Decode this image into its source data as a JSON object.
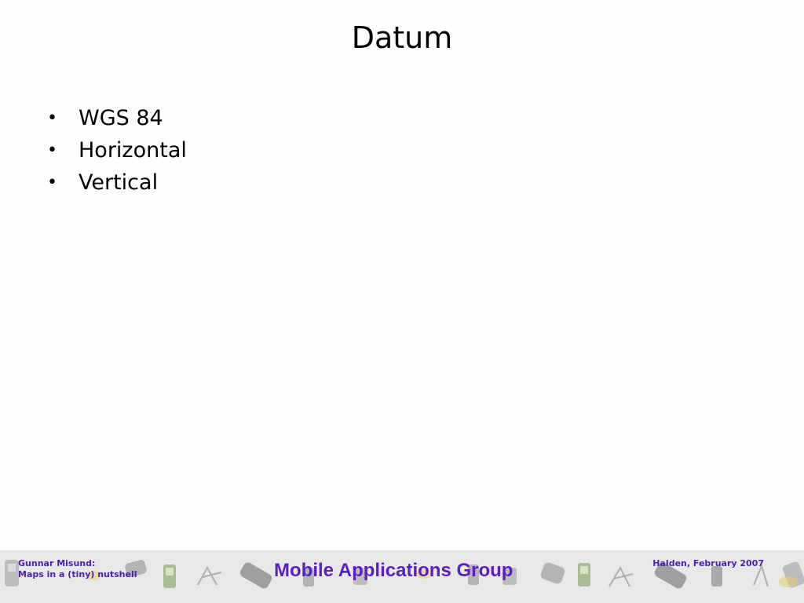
{
  "slide": {
    "title": "Datum",
    "bullets": [
      {
        "marker": "•",
        "text": "WGS 84"
      },
      {
        "marker": "•",
        "text": "Horizontal"
      },
      {
        "marker": "•",
        "text": "Vertical"
      }
    ]
  },
  "footer": {
    "author_line": "Gunnar Misund:",
    "talk_line": "Maps in a (tiny) nutshell",
    "group": "Mobile Applications Group",
    "place_date": "Halden, February 2007",
    "text_color": "#4b1fb0",
    "band_color": "#e8e8e8",
    "decor_icons": [
      "phone-icon",
      "pda-icon",
      "satellite-icon",
      "gps-device-icon",
      "handheld-icon"
    ]
  }
}
